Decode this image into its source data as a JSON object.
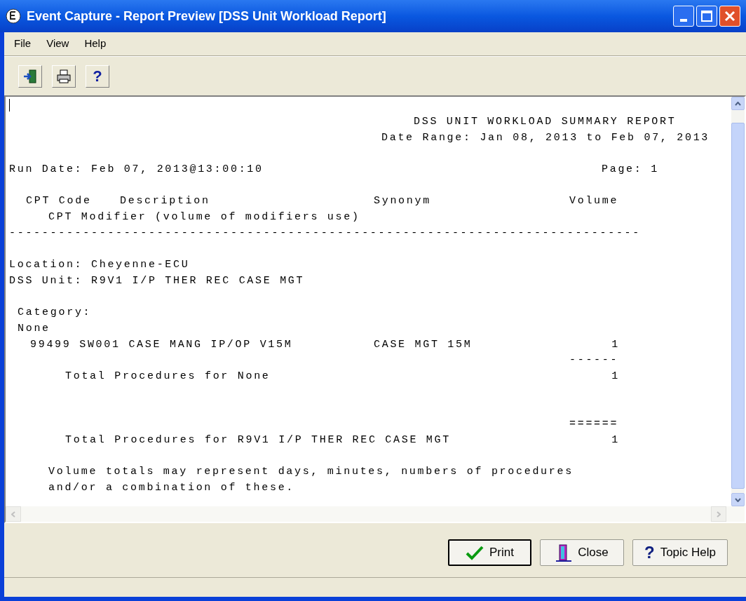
{
  "window": {
    "title": "Event Capture - Report Preview [DSS Unit Workload Report]"
  },
  "menu": [
    {
      "label": "File"
    },
    {
      "label": "View"
    },
    {
      "label": "Help"
    }
  ],
  "toolbar": [
    {
      "kind": "exit"
    },
    {
      "kind": "print"
    },
    {
      "kind": "help",
      "glyph": "?"
    }
  ],
  "report": {
    "title": "DSS UNIT WORKLOAD SUMMARY REPORT",
    "date_range": "Date Range: Jan 08, 2013 to Feb 07, 2013",
    "run_date": "Run Date: Feb 07, 2013@13:00:10",
    "page": "Page: 1",
    "columns": [
      "CPT Code",
      "Description",
      "Synonym",
      "Volume"
    ],
    "subheading": "CPT Modifier (volume of modifiers use)",
    "separator": "-----------------------------------------------------------------------------",
    "location": "Location: Cheyenne-ECU",
    "dss_unit": "DSS Unit: R9V1 I/P THER REC CASE MGT",
    "category_label": "Category:",
    "category": "None",
    "rows": [
      {
        "procedure": "99499 SW001 CASE MANG IP/OP V15M",
        "synonym": "CASE MGT 15M",
        "volume": "1"
      }
    ],
    "subtotal_rule": "------",
    "subtotal": {
      "label": "Total Procedures for None",
      "volume": "1"
    },
    "total_rule": "======",
    "total": {
      "label": "Total Procedures for R9V1 I/P THER REC CASE MGT",
      "volume": "1"
    },
    "note": [
      "Volume totals may represent days, minutes, numbers of procedures",
      "and/or a combination of these."
    ]
  },
  "buttons": [
    {
      "kind": "print",
      "label": "Print",
      "default": true
    },
    {
      "kind": "close",
      "label": "Close",
      "default": false
    },
    {
      "kind": "help",
      "label": "Topic Help",
      "glyph": "?",
      "default": false
    }
  ]
}
